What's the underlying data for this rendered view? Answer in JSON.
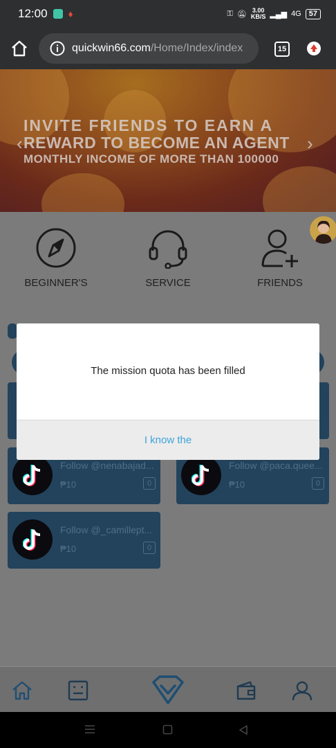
{
  "status_bar": {
    "time": "12:00",
    "net_rate_value": "3.00",
    "net_rate_unit": "KB/S",
    "network": "4G",
    "battery": "57"
  },
  "browser": {
    "url_domain": "quickwin66.com",
    "url_path": "/Home/Index/index",
    "tab_count": "15"
  },
  "banner": {
    "line1": "INVITE FRIENDS TO EARN A",
    "line2": "REWARD TO BECOME AN AGENT",
    "line3": "MONTHLY INCOME OF MORE THAN 100000",
    "prev_arrow": "‹",
    "next_arrow": "›"
  },
  "quick_links": [
    {
      "label": "BEGINNER'S",
      "icon": "compass-icon"
    },
    {
      "label": "SERVICE",
      "icon": "headset-icon"
    },
    {
      "label": "FRIENDS",
      "icon": "add-friend-icon"
    }
  ],
  "tasks": [
    {
      "title": "Follow @nenabajad...",
      "price": "₱10",
      "count": "0"
    },
    {
      "title": "Follow @paca.quee...",
      "price": "₱10",
      "count": "0"
    },
    {
      "title": "Follow @_camillept...",
      "price": "₱10",
      "count": "0"
    }
  ],
  "modal": {
    "message": "The mission quota has been filled",
    "button": "I know the"
  },
  "tabbar": [
    "home-icon",
    "task-list-icon",
    "brand-icon",
    "wallet-icon",
    "profile-icon"
  ],
  "colors": {
    "accent": "#3da3db",
    "task_card": "#23435c",
    "browser_chrome": "#2e2f31"
  }
}
